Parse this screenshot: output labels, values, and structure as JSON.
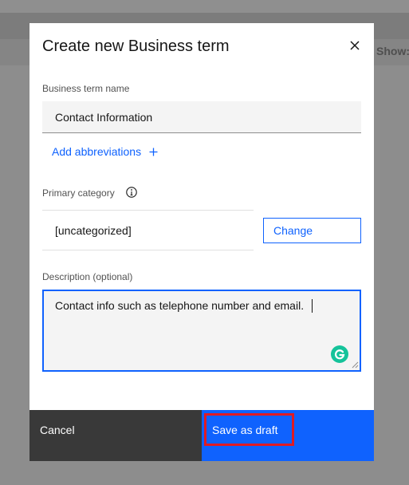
{
  "background": {
    "show_label": "Show:"
  },
  "modal": {
    "title": "Create new Business term",
    "name_label": "Business term name",
    "name_value": "Contact Information",
    "add_abbreviations": "Add abbreviations",
    "primary_category_label": "Primary category",
    "category_value": "[uncategorized]",
    "change_button": "Change",
    "description_label": "Description (optional)",
    "description_value": "Contact info such as telephone number and email.",
    "cancel_button": "Cancel",
    "save_button": "Save as draft"
  },
  "colors": {
    "accent": "#0f62fe",
    "secondary_button": "#393939",
    "highlight": "#e01b24",
    "grammarly": "#15c39a"
  },
  "icons": [
    "close-icon",
    "plus-icon",
    "info-icon",
    "grammarly-icon",
    "resize-grip-icon"
  ]
}
